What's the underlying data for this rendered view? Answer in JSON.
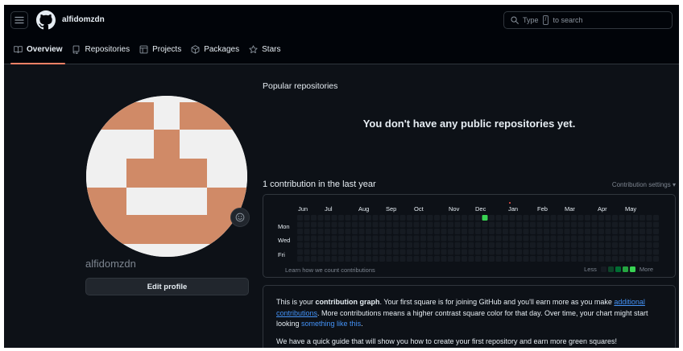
{
  "header": {
    "username": "alfidomzdn",
    "search_placeholder_prefix": "Type",
    "search_key": "/",
    "search_placeholder_suffix": "to search"
  },
  "tabs": [
    {
      "label": "Overview",
      "icon": "book-icon",
      "active": true
    },
    {
      "label": "Repositories",
      "icon": "repo-icon"
    },
    {
      "label": "Projects",
      "icon": "table-icon"
    },
    {
      "label": "Packages",
      "icon": "package-icon"
    },
    {
      "label": "Stars",
      "icon": "star-icon"
    }
  ],
  "profile": {
    "name": "alfidomzdn",
    "edit_label": "Edit profile",
    "avatar_colors": {
      "primary": "#d08a67",
      "background": "#f0f0f0"
    }
  },
  "popular": {
    "title": "Popular repositories",
    "empty_message": "You don't have any public repositories yet."
  },
  "contributions": {
    "title": "1 contribution in the last year",
    "settings_label": "Contribution settings ▾",
    "months": [
      "Jun",
      "Jul",
      "Aug",
      "Sep",
      "Oct",
      "Nov",
      "Dec",
      "Jan",
      "Feb",
      "Mar",
      "Apr",
      "May"
    ],
    "days": [
      "Mon",
      "Wed",
      "Fri"
    ],
    "active_cell": {
      "week": 27,
      "day": 0,
      "color": "#39d353"
    },
    "learn_link": "Learn how we count contributions",
    "legend_less": "Less",
    "legend_more": "More",
    "legend_colors": [
      "#161b22",
      "#0e4429",
      "#006d32",
      "#26a641",
      "#39d353"
    ]
  },
  "info": {
    "p1_a": "This is your ",
    "p1_bold": "contribution graph",
    "p1_b": ". Your first square is for joining GitHub and you'll earn more as you make ",
    "p1_link1": "additional contributions",
    "p1_c": ". More contributions means a higher contrast square color for that day. Over time, your chart might start looking ",
    "p1_link2": "something like this",
    "p1_d": ".",
    "p2": "We have a quick guide that will show you how to create your first repository and earn more green squares!"
  }
}
